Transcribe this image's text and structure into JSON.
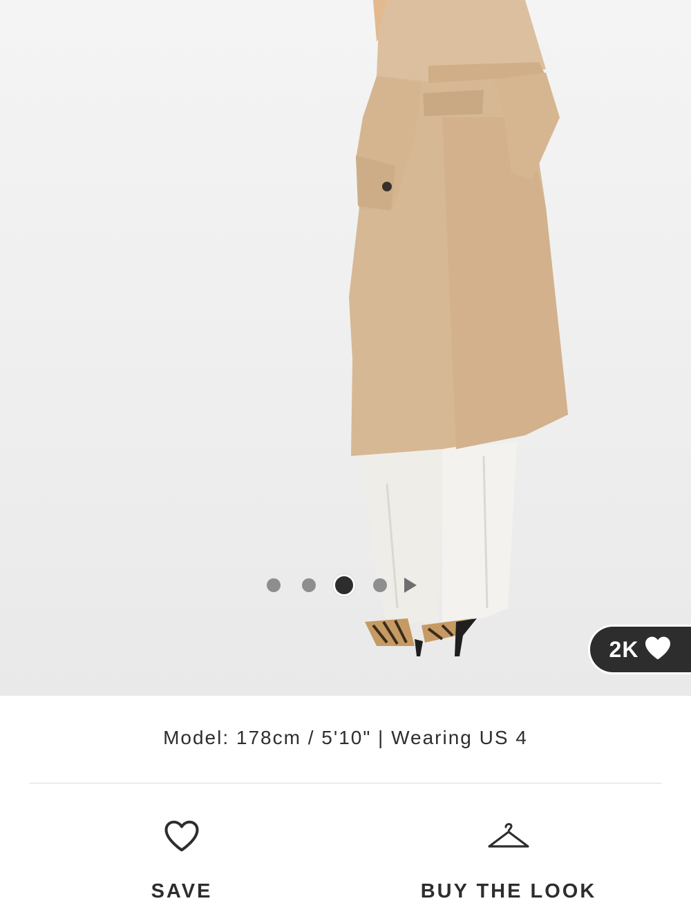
{
  "product_image": {
    "alt_icon": "product-photo",
    "carousel": {
      "total_slides": 4,
      "active_index": 2
    }
  },
  "likes": {
    "count_label": "2K",
    "icon": "heart-filled-icon"
  },
  "model_info": "Model: 178cm / 5'10\" | Wearing US 4",
  "actions": {
    "save": {
      "label": "SAVE",
      "icon": "heart-outline-icon"
    },
    "buy_the_look": {
      "label": "BUY THE LOOK",
      "icon": "hanger-icon"
    }
  }
}
